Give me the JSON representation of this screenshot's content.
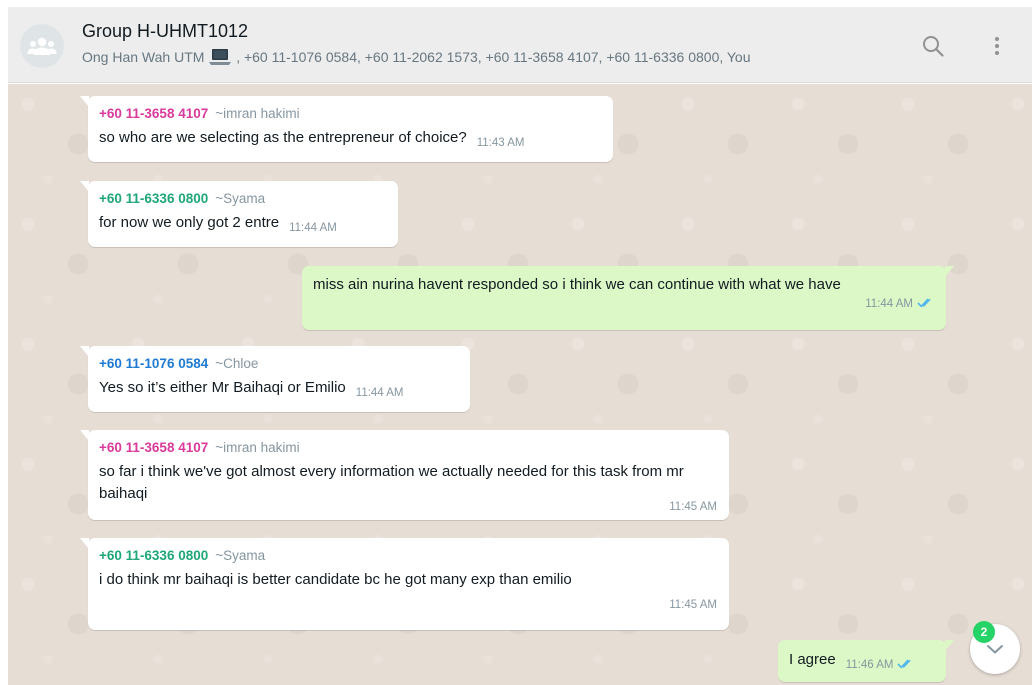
{
  "header": {
    "title": "Group H-UHMT1012",
    "participants_prefix": "Ong Han Wah UTM",
    "participants_rest": ", +60 11-1076 0584, +60 11-2062 1573, +60 11-3658 4107, +60 11-6336 0800, You",
    "icons": {
      "avatar": "group-icon",
      "search": "search-icon",
      "menu": "kebab-menu-icon"
    }
  },
  "colors": {
    "header_bg": "#ededed",
    "chat_bg": "#e6ddd4",
    "incoming_bg": "#ffffff",
    "outgoing_bg": "#dcf8c6",
    "sender_pink": "#d93a9c",
    "sender_green": "#1fa67a",
    "sender_blue": "#1f7bd1",
    "read_ticks": "#4fb6ec",
    "badge": "#25d366"
  },
  "messages": [
    {
      "direction": "in",
      "sender": "+60 11-3658 4107",
      "alias": "~imran hakimi",
      "text": "so who are we selecting as the entrepreneur of choice?",
      "time": "11:43 AM"
    },
    {
      "direction": "in",
      "sender": "+60 11-6336 0800",
      "alias": "~Syama",
      "text": "for now we only got 2 entre",
      "time": "11:44 AM"
    },
    {
      "direction": "out",
      "text": "miss ain nurina havent responded so i think we can continue with what we have",
      "time": "11:44 AM",
      "status": "read"
    },
    {
      "direction": "in",
      "sender": "+60 11-1076 0584",
      "alias": "~Chloe",
      "text": "Yes so it’s either Mr Baihaqi or Emilio",
      "time": "11:44 AM"
    },
    {
      "direction": "in",
      "sender": "+60 11-3658 4107",
      "alias": "~imran hakimi",
      "text": "so far i think we've got almost every information we actually needed for this task from mr baihaqi",
      "time": "11:45 AM"
    },
    {
      "direction": "in",
      "sender": "+60 11-6336 0800",
      "alias": "~Syama",
      "text": "i do think mr baihaqi is better candidate bc he got many exp than emilio",
      "time": "11:45 AM"
    },
    {
      "direction": "out",
      "text": "I agree",
      "time": "11:46 AM",
      "status": "read"
    }
  ],
  "scroll_down": {
    "unread_count": "2",
    "icon": "chevron-down-icon"
  }
}
